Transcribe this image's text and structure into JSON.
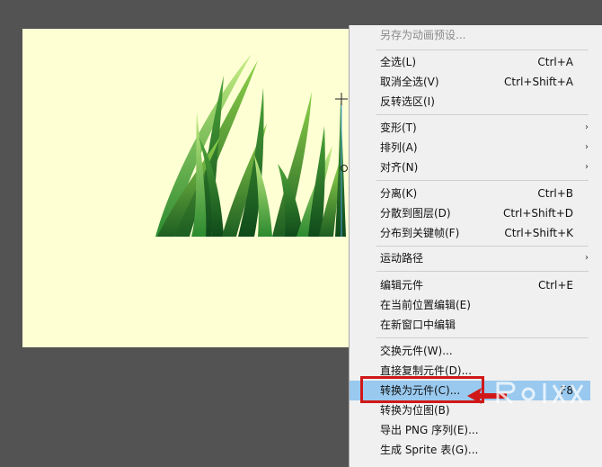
{
  "menu": {
    "items": [
      {
        "label": "另存为动画预设...",
        "shortcut": "",
        "disabled": true
      },
      {
        "label": "全选(L)",
        "shortcut": "Ctrl+A"
      },
      {
        "label": "取消全选(V)",
        "shortcut": "Ctrl+Shift+A"
      },
      {
        "label": "反转选区(I)",
        "shortcut": ""
      },
      {
        "label": "变形(T)",
        "shortcut": "",
        "submenu": true
      },
      {
        "label": "排列(A)",
        "shortcut": "",
        "submenu": true
      },
      {
        "label": "对齐(N)",
        "shortcut": "",
        "submenu": true
      },
      {
        "label": "分离(K)",
        "shortcut": "Ctrl+B"
      },
      {
        "label": "分散到图层(D)",
        "shortcut": "Ctrl+Shift+D"
      },
      {
        "label": "分布到关键帧(F)",
        "shortcut": "Ctrl+Shift+K"
      },
      {
        "label": "运动路径",
        "shortcut": "",
        "submenu": true
      },
      {
        "label": "编辑元件",
        "shortcut": "Ctrl+E"
      },
      {
        "label": "在当前位置编辑(E)",
        "shortcut": ""
      },
      {
        "label": "在新窗口中编辑",
        "shortcut": ""
      },
      {
        "label": "交换元件(W)...",
        "shortcut": ""
      },
      {
        "label": "直接复制元件(D)...",
        "shortcut": ""
      },
      {
        "label": "转换为元件(C)...",
        "shortcut": "F8",
        "highlighted": true
      },
      {
        "label": "转换为位图(B)",
        "shortcut": ""
      },
      {
        "label": "导出 PNG 序列(E)...",
        "shortcut": ""
      },
      {
        "label": "生成 Sprite 表(G)...",
        "shortcut": ""
      }
    ],
    "submenu_glyph": "›"
  },
  "colors": {
    "workspace": "#535353",
    "stage": "#ffffd4",
    "menu_bg": "#f0f0f0",
    "highlight": "#99c9ef",
    "callout": "#d01818"
  },
  "icons": [
    "grass-illustration",
    "selection-crosshair-icon",
    "transform-point-icon",
    "red-arrow-icon",
    "watermark-logo"
  ]
}
